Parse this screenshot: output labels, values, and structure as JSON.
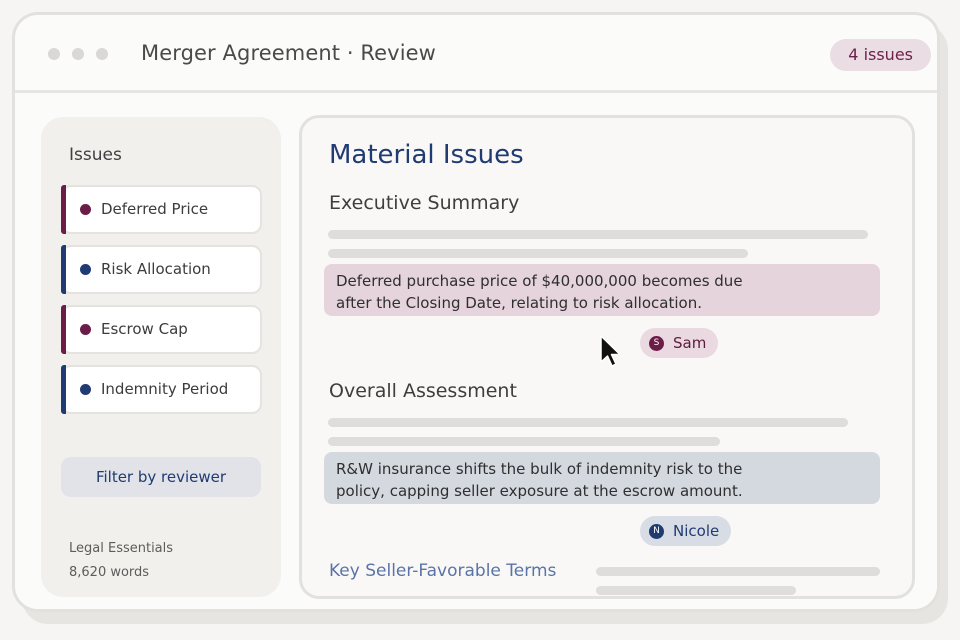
{
  "window": {
    "title": "Merger Agreement · Review",
    "issues_badge": "4 issues"
  },
  "sidebar": {
    "heading": "Issues",
    "items": [
      {
        "label": "Deferred Price",
        "color": "#6b1d48"
      },
      {
        "label": "Risk Allocation",
        "color": "#1f3b72"
      },
      {
        "label": "Escrow Cap",
        "color": "#6b1d48"
      },
      {
        "label": "Indemnity Period",
        "color": "#1f3b72"
      }
    ],
    "filter_label": "Filter by reviewer",
    "meta_category": "Legal Essentials",
    "meta_words": "8,620 words"
  },
  "main": {
    "title": "Material Issues",
    "sections": [
      {
        "heading": "Executive Summary",
        "highlight_lines": [
          "Deferred purchase price of $40,000,000 becomes due",
          "after the Closing Date, relating to risk allocation."
        ],
        "reviewer": {
          "initial": "S",
          "name": "Sam"
        }
      },
      {
        "heading": "Overall Assessment",
        "highlight_lines": [
          "R&W insurance shifts the bulk of indemnity risk to the",
          "policy, capping seller exposure at the escrow amount."
        ],
        "reviewer": {
          "initial": "N",
          "name": "Nicole"
        }
      }
    ],
    "next_section_link": "Key Seller-Favorable Terms"
  },
  "colors": {
    "plum": "#6b1d48",
    "navy": "#1f3b72",
    "plum_highlight": "#e5d4db",
    "navy_highlight": "#d4d9e0"
  }
}
